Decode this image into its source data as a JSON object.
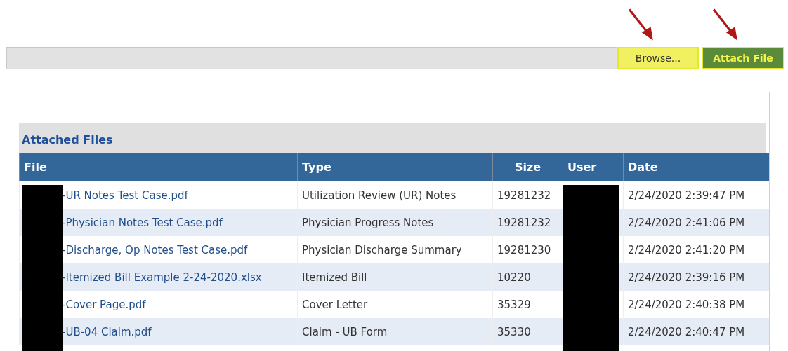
{
  "upload_bar": {
    "buttons": [
      {
        "label": "Browse...",
        "kind": "browse"
      },
      {
        "label": "Attach File",
        "kind": "attach"
      }
    ]
  },
  "attached_files": {
    "title": "Attached Files",
    "columns": [
      "File",
      "Type",
      "Size",
      "User",
      "Date"
    ],
    "rows": [
      {
        "file": "-UR Notes Test Case.pdf",
        "type": "Utilization Review (UR) Notes",
        "size": "19281232",
        "date": "2/24/2020 2:39:47 PM"
      },
      {
        "file": "-Physician Notes Test Case.pdf",
        "type": "Physician Progress Notes",
        "size": "19281232",
        "date": "2/24/2020 2:41:06 PM"
      },
      {
        "file": "-Discharge, Op Notes Test Case.pdf",
        "type": "Physician Discharge Summary",
        "size": "19281230",
        "date": "2/24/2020 2:41:20 PM"
      },
      {
        "file": "-Itemized Bill Example 2-24-2020.xlsx",
        "type": "Itemized Bill",
        "size": "10220",
        "date": "2/24/2020 2:39:16 PM"
      },
      {
        "file": "-Cover Page.pdf",
        "type": "Cover Letter",
        "size": "35329",
        "date": "2/24/2020 2:40:38 PM"
      },
      {
        "file": "-UB-04 Claim.pdf",
        "type": "Claim - UB Form",
        "size": "35330",
        "date": "2/24/2020 2:40:47 PM"
      }
    ]
  }
}
